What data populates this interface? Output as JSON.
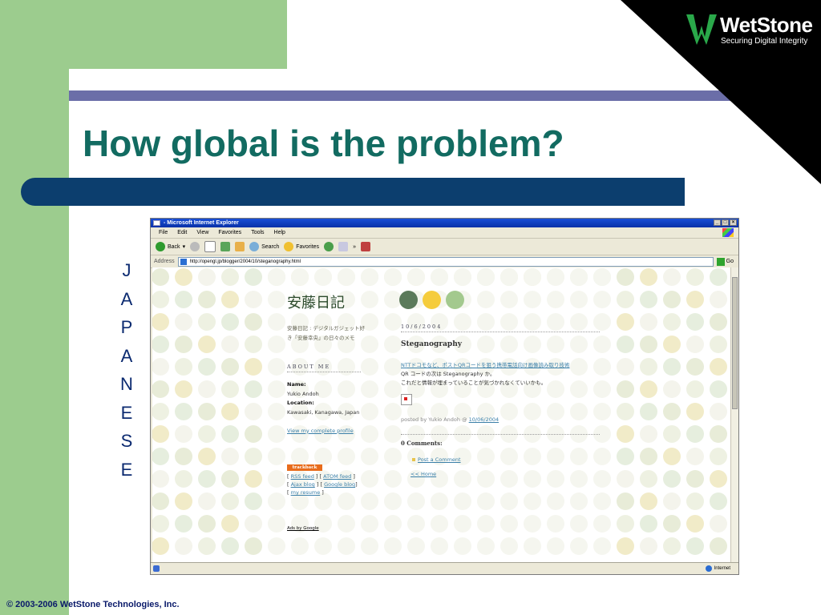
{
  "slide": {
    "title": "How global is the problem?",
    "vertical_letters": [
      "J",
      "A",
      "P",
      "A",
      "N",
      "E",
      "S",
      "E"
    ],
    "footer": "© 2003-2006  WetStone Technologies, Inc.",
    "logo_name": "WetStone",
    "logo_tagline": "Securing Digital Integrity",
    "colors": {
      "title": "#126b61",
      "green": "#9ccc8e",
      "navy": "#0c3e6e",
      "purple": "#6b6ea8"
    }
  },
  "browser": {
    "window_title": "- Microsoft Internet Explorer",
    "menu": [
      "File",
      "Edit",
      "View",
      "Favorites",
      "Tools",
      "Help"
    ],
    "toolbar": {
      "back": "Back",
      "search": "Search",
      "favorites": "Favorites",
      "chevrons": "»"
    },
    "address_label": "Address",
    "address_value": "http://opengl.jp/blogger/2004/10/steganography.html",
    "go_label": "Go",
    "status_zone": "Internet"
  },
  "blog": {
    "title": "安藤日記",
    "description": "安藤日記 : デジタルガジェット好き「安藤幸央」の日々のメモ",
    "about_heading": "ABOUT ME",
    "name_label": "Name:",
    "name_value": "Yukio Andoh",
    "location_label": "Location:",
    "location_value": "Kawasaki, Kanagawa, Japan",
    "profile_link": "View my complete profile",
    "trackback_badge": "trackback",
    "feeds_line1_a": "RSS feed",
    "feeds_line1_b": "ATOM feed",
    "feeds_line2_a": "Ajax blog",
    "feeds_line2_b": "Google blog",
    "feeds_line3": "my resume",
    "ads_label": "Ads by Google",
    "post_date": "10/6/2004",
    "post_title": "Steganography",
    "post_link": "NTTドコモなど、ポストQRコードを狙う携帯電話向け画像読み取り技術",
    "post_body_1": "QR コードの次は Steganography か。",
    "post_body_2": "これだと情報が埋まっていることが気づかれなくていいかも。",
    "posted_by": "posted by Yukio Andoh @ ",
    "posted_date": "10/06/2004",
    "comments_heading": "0 Comments:",
    "post_comment": "Post a Comment",
    "home_link": "<< Home"
  }
}
